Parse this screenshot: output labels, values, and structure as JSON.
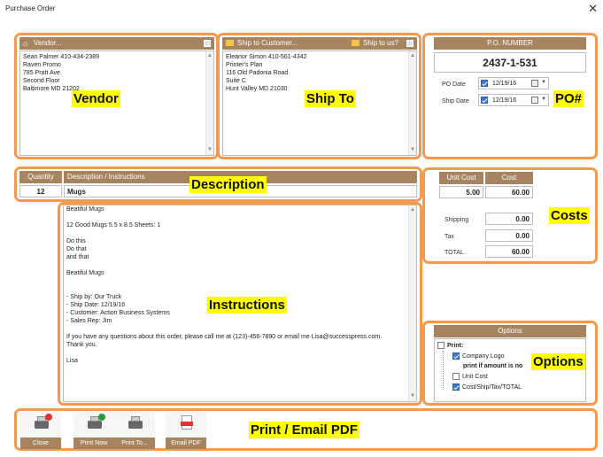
{
  "window": {
    "title": "Purchase Order",
    "close_glyph": "✕"
  },
  "vendor": {
    "header_label": "Vendor...",
    "lines": [
      "Sean Palmer 410-434-2389",
      "Raven Promo",
      "785 Pratt Ave.",
      "Second Floor",
      "Baltimore MD 21202"
    ],
    "tag": "Vendor"
  },
  "shipto": {
    "header_label": "Ship to Customer...",
    "ship_to_us_label": "Ship to us?",
    "lines": [
      "Eleanor Simon 410-561-4342",
      "Printer's Plan",
      "116 Old Padonia Road",
      "Suite C",
      "Hunt Valley MD 21030"
    ],
    "tag": "Ship To"
  },
  "po": {
    "header_label": "P.O. NUMBER",
    "number": "2437-1-531",
    "po_date_label": "PO Date",
    "po_date": "12/19/16",
    "ship_date_label": "Ship Date",
    "ship_date": "12/19/16",
    "tag": "PO#"
  },
  "description": {
    "quantity_header": "Quantity",
    "desc_header": "Description / Instructions",
    "quantity": "12",
    "desc": "Mugs",
    "tag": "Description"
  },
  "instructions": {
    "lines": [
      "Beatiful Mugs",
      "",
      "12 Good Mugs 5.5 x 8.5   Sheets: 1",
      "",
      "Do this",
      "Do that",
      "and that",
      "",
      "Beatiful Mugs",
      "",
      "",
      "- Ship by: Our Truck",
      "- Ship Date:  12/19/16",
      "- Customer: Action Business Systems",
      "- Sales Rep: Jim",
      "",
      "If you have any questions about this order, please call me at (123)-456-7890 or email me Lisa@successpress.com.",
      "Thank you.",
      "",
      "Lisa"
    ],
    "tag": "Instructions"
  },
  "costs": {
    "unit_cost_header": "Unit Cost",
    "cost_header": "Cost",
    "unit_cost": "5.00",
    "cost": "60.00",
    "shipping_label": "Shipping",
    "shipping": "0.00",
    "tax_label": "Tax",
    "tax": "0.00",
    "total_label": "TOTAL",
    "total": "60.00",
    "tag": "Costs"
  },
  "options": {
    "header_label": "Options",
    "print_label": "Print:",
    "company_logo": "Company Logo",
    "print_if_amount": "print if amount is no",
    "unit_cost": "Unit Cost",
    "cost_ship_tax": "Cost/Ship/Tax/TOTAL",
    "tag": "Options"
  },
  "toolbar": {
    "close": "Close",
    "print_now": "Print Now",
    "print_to": "Print To...",
    "email_pdf": "Email PDF",
    "tag": "Print / Email PDF"
  },
  "colors": {
    "frame": "#f29a4e",
    "header": "#a6845f",
    "tag": "#ffff00",
    "check": "#3c76c9"
  }
}
